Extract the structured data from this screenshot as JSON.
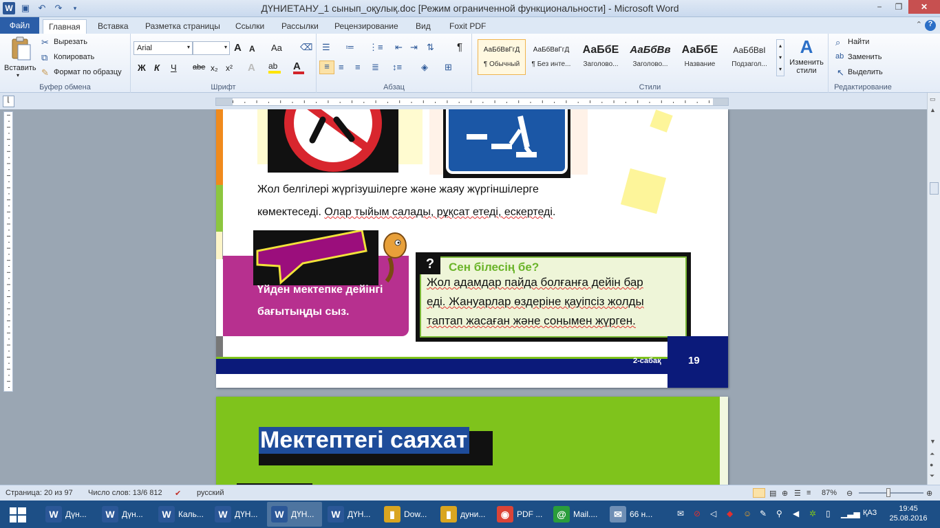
{
  "window": {
    "title": "ДҮНИЕТАНУ_1 сынып_оқулық.doc [Режим ограниченной функциональности] - Microsoft Word",
    "minimize": "−",
    "restore": "❐",
    "close": "✕"
  },
  "tabs": {
    "file": "Файл",
    "items": [
      "Главная",
      "Вставка",
      "Разметка страницы",
      "Ссылки",
      "Рассылки",
      "Рецензирование",
      "Вид",
      "Foxit PDF"
    ],
    "help": "⌃",
    "helpq": "?"
  },
  "ribbon": {
    "clipboard": {
      "label": "Буфер обмена",
      "paste": "Вставить",
      "cut": "Вырезать",
      "copy": "Копировать",
      "format_painter": "Формат по образцу"
    },
    "font": {
      "label": "Шрифт",
      "font_name": "Arial",
      "font_size": "",
      "bold": "Ж",
      "italic": "К",
      "underline": "Ч",
      "strike": "abe",
      "sub": "x₂",
      "sup": "x²",
      "grow": "A",
      "shrink": "A",
      "case": "Aa",
      "clear": "A"
    },
    "paragraph": {
      "label": "Абзац",
      "pilcrow": "¶"
    },
    "styles": {
      "label": "Стили",
      "items": [
        {
          "preview": "АаБбВвГгД",
          "name": "¶ Обычный"
        },
        {
          "preview": "АаБбВвГгД",
          "name": "¶ Без инте..."
        },
        {
          "preview": "АаБбЕ",
          "name": "Заголово..."
        },
        {
          "preview": "АаБбВв",
          "name": "Заголово..."
        },
        {
          "preview": "АаБбЕ",
          "name": "Название"
        },
        {
          "preview": "АаБбВвІ",
          "name": "Подзагол..."
        }
      ],
      "change": "Изменить стили"
    },
    "editing": {
      "label": "Редактирование",
      "find": "Найти",
      "replace": "Заменить",
      "select": "Выделить"
    }
  },
  "page1": {
    "line1": "Жол белгілері жүргізушілерге және жаяу жүргіншілерге",
    "line2a": "көмектеседі. ",
    "line2b": "Олар тыйым салады, рұқсат етеді, ескертеді",
    "line2c": ".",
    "task_line1": "Үйден мектепке дейінгі",
    "task_line2": "бағытыңды сыз.",
    "box_q": "?",
    "box_title": "Сен білесің бе?",
    "box_line1": "Жол адамдар пайда болғанға дейін бар",
    "box_line2": "еді. Жануарлар өздеріне қауіпсіз жолды",
    "box_line3": "таптап жасаған және сонымен жүрген.",
    "footer_lesson": "2-сабақ",
    "page_number": "19"
  },
  "page2": {
    "heading": "Мектептегі саяхат"
  },
  "statusbar": {
    "page": "Страница: 20 из 97",
    "words": "Число слов: 13/6 812",
    "lang": "русский",
    "zoom": "87%"
  },
  "taskbar": {
    "items": [
      {
        "label": "Дүн...",
        "icon": "W",
        "color": "#2b5797"
      },
      {
        "label": "Дүн...",
        "icon": "W",
        "color": "#2b5797"
      },
      {
        "label": "Каль...",
        "icon": "W",
        "color": "#2b5797"
      },
      {
        "label": "ДҮН...",
        "icon": "W",
        "color": "#2b5797"
      },
      {
        "label": "ДҮН...",
        "icon": "W",
        "color": "#2b5797"
      },
      {
        "label": "ДҮН...",
        "icon": "W",
        "color": "#2b5797"
      },
      {
        "label": "Dow...",
        "icon": "▮",
        "color": "#d9a520"
      },
      {
        "label": "дуни...",
        "icon": "▮",
        "color": "#d9a520"
      },
      {
        "label": "PDF ...",
        "icon": "◉",
        "color": "#db4437"
      },
      {
        "label": "Mail....",
        "icon": "@",
        "color": "#2a9d3b"
      },
      {
        "label": "66 н...",
        "icon": "✉",
        "color": "#6f8fb5"
      }
    ],
    "lang": "ҚАЗ",
    "time": "19:45",
    "date": "25.08.2016"
  }
}
